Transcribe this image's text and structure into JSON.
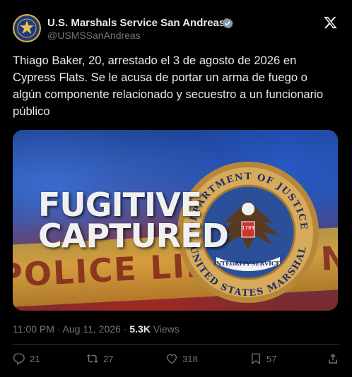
{
  "author": {
    "name": "U.S. Marshals Service San Andreas",
    "handle": "@USMSSanAndreas",
    "verified": true
  },
  "tweet": {
    "text": "Thiago Baker, 20, arrestado el 3 de agosto de 2026 en Cypress Flats. Se le acusa de portar un arma de fuego o algún componente relacionado y secuestro a un funcionario público",
    "image": {
      "headline_line1": "FUGITIVE",
      "headline_line2": "CAPTURED",
      "tape_text": "POLICE LINE DO NOT CROSS",
      "seal_text_top": "DEPARTMENT OF JUSTICE",
      "seal_text_bottom": "UNITED STATES MARSHAL",
      "seal_ribbon_left": "INTEGRITY",
      "seal_ribbon_right": "SERVICE",
      "seal_year": "1789"
    },
    "time": "11:00 PM · Aug 11, 2026 · ",
    "views_count": "5.3K",
    "views_label": " Views"
  },
  "actions": {
    "replies": "21",
    "reposts": "27",
    "likes": "318",
    "bookmarks": "57"
  },
  "icons": [
    "usms-logo-icon",
    "verified-badge-icon",
    "x-logo-icon",
    "reply-icon",
    "repost-icon",
    "like-icon",
    "bookmark-icon",
    "share-icon"
  ],
  "colors": {
    "background": "#000000",
    "text": "#e7e9ea",
    "muted": "#71767b",
    "verified": "#829aab"
  }
}
